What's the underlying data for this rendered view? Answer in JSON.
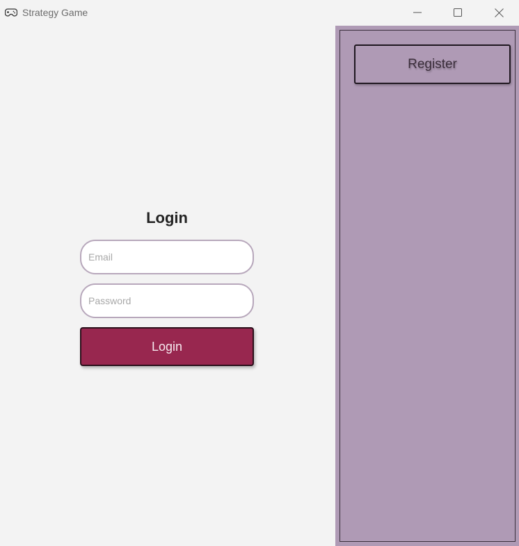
{
  "window": {
    "title": "Strategy Game",
    "app_icon": "gamepad-icon",
    "controls": [
      "minimize-icon",
      "maximize-icon",
      "close-icon"
    ]
  },
  "login": {
    "heading": "Login",
    "email_placeholder": "Email",
    "email_value": "",
    "password_placeholder": "Password",
    "password_value": "",
    "submit_label": "Login"
  },
  "sidebar": {
    "register_label": "Register"
  },
  "colors": {
    "background": "#f3f3f3",
    "login_button": "#98274f",
    "side_panel": "#af9ab5",
    "input_border": "#b7a7bb"
  }
}
